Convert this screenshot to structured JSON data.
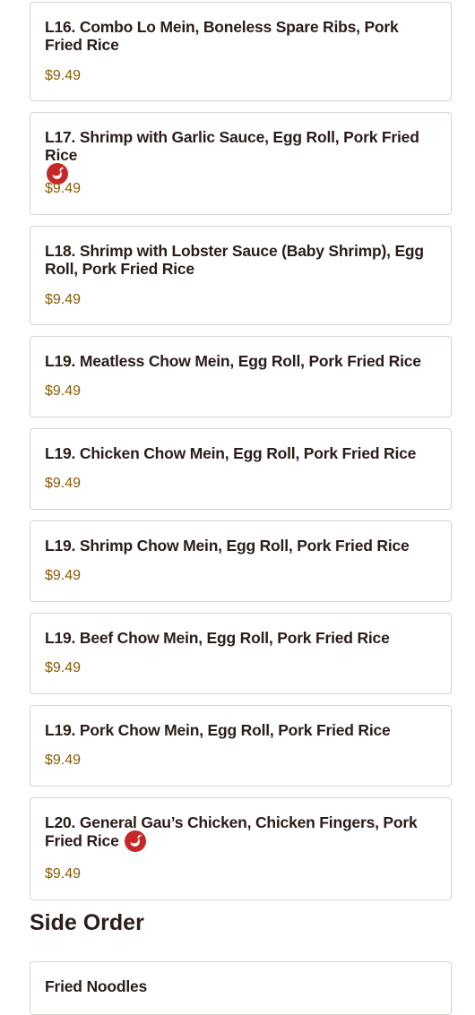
{
  "items": [
    {
      "name": "L16. Combo Lo Mein, Boneless Spare Ribs, Pork Fried Rice",
      "price": "$9.49",
      "spicy": false
    },
    {
      "name": "L17. Shrimp with Garlic Sauce, Egg Roll, Pork Fried Rice",
      "price": "$9.49",
      "spicy": true
    },
    {
      "name": "L18. Shrimp with Lobster Sauce (Baby Shrimp), Egg Roll, Pork Fried Rice",
      "price": "$9.49",
      "spicy": false
    },
    {
      "name": "L19. Meatless Chow Mein, Egg Roll, Pork Fried Rice",
      "price": "$9.49",
      "spicy": false
    },
    {
      "name": "L19. Chicken Chow Mein, Egg Roll, Pork Fried Rice",
      "price": "$9.49",
      "spicy": false
    },
    {
      "name": "L19. Shrimp Chow Mein, Egg Roll, Pork Fried Rice",
      "price": "$9.49",
      "spicy": false
    },
    {
      "name": "L19. Beef Chow Mein, Egg Roll, Pork Fried Rice",
      "price": "$9.49",
      "spicy": false
    },
    {
      "name": "L19. Pork Chow Mein, Egg Roll, Pork Fried Rice",
      "price": "$9.49",
      "spicy": false
    },
    {
      "name": "L20. General Gau’s Chicken, Chicken Fingers, Pork Fried Rice",
      "price": "$9.49",
      "spicy": true
    }
  ],
  "section": {
    "title": "Side Order",
    "items": [
      {
        "name": "Fried Noodles"
      }
    ]
  },
  "icons": {
    "spicy": "hot-pepper-icon"
  },
  "colors": {
    "price": "#8a5a00",
    "spicy_badge": "#c62828",
    "text": "#2b1d1a",
    "border": "#d9d2cc"
  }
}
